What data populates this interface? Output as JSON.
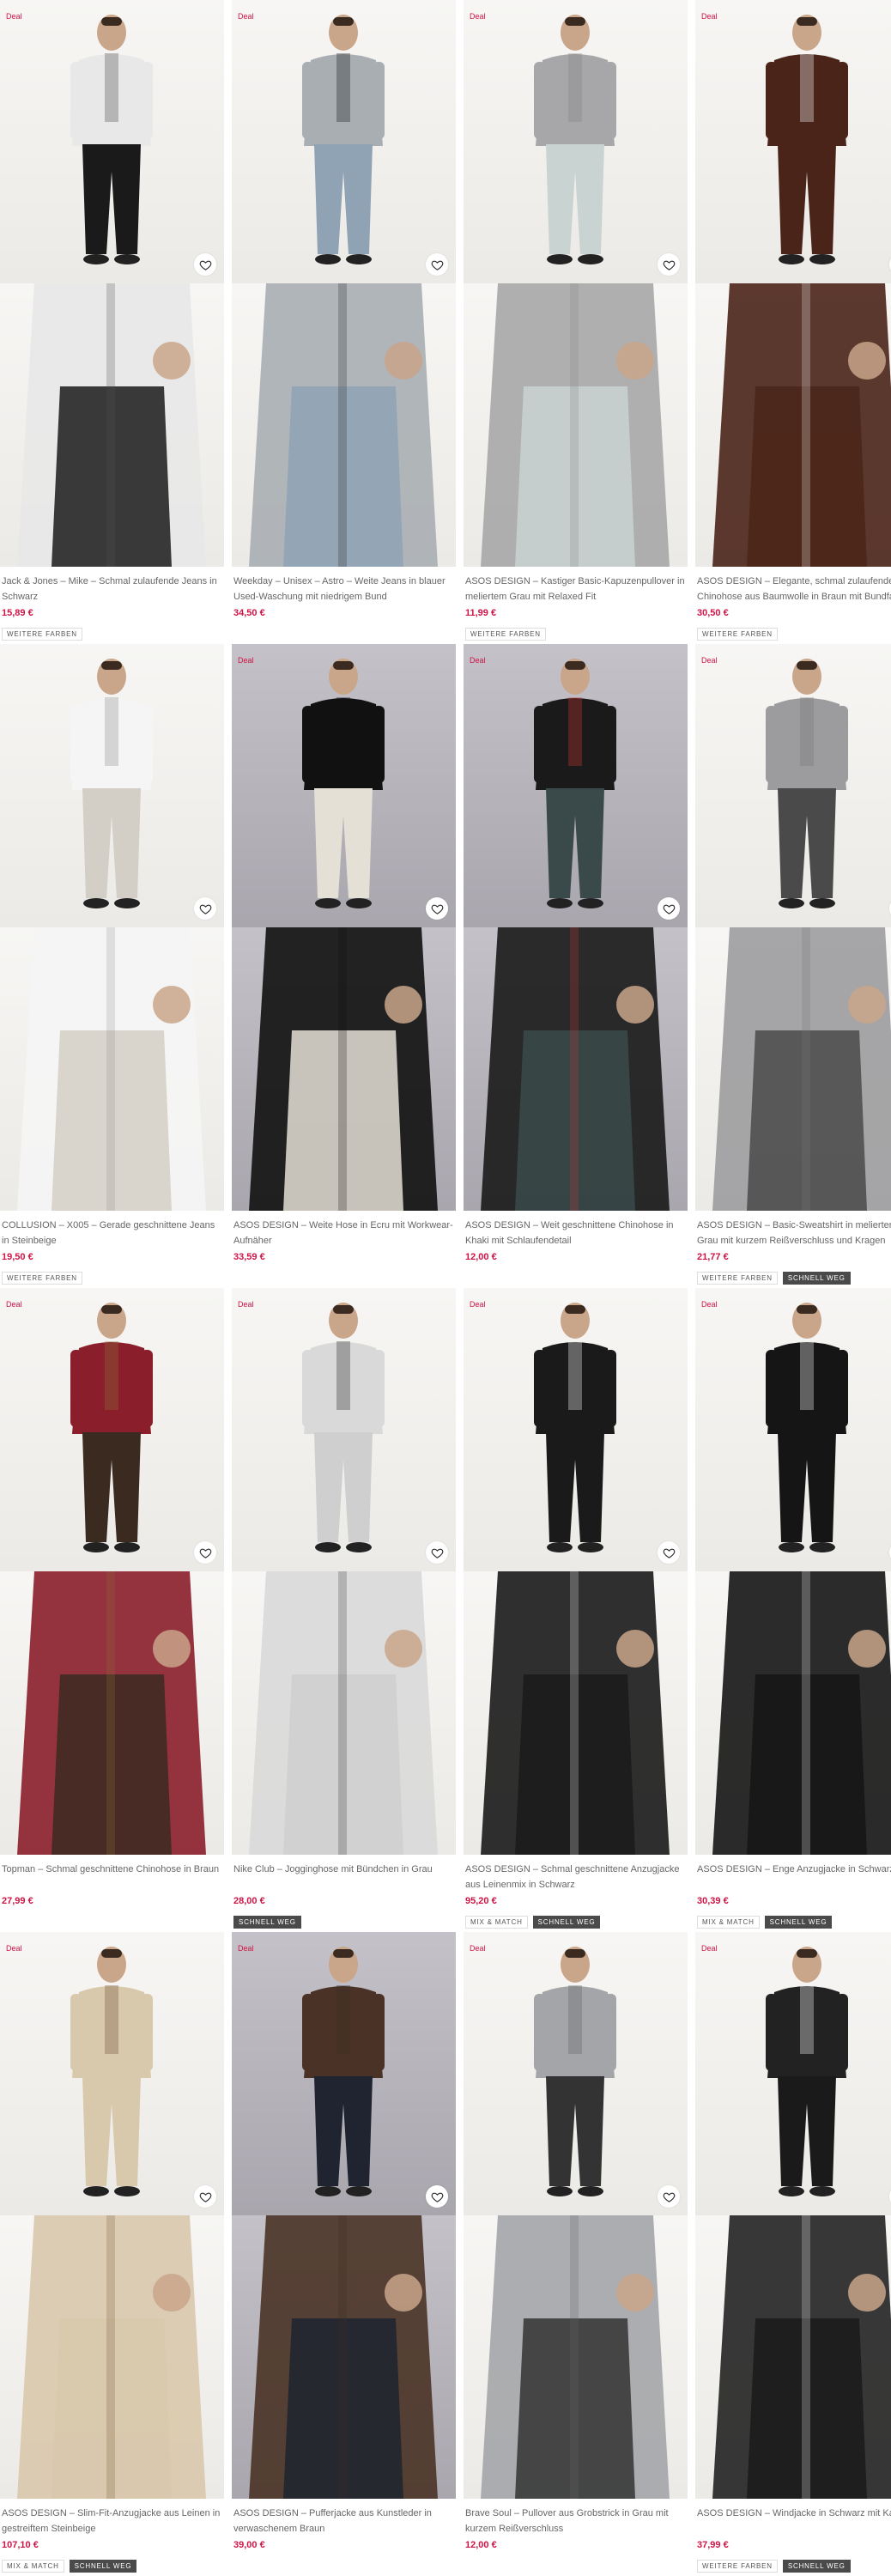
{
  "deal_label": "Deal",
  "products": [
    {
      "title": "Jack & Jones – Mike – Schmal zulaufende Jeans in Schwarz",
      "price": "15,89 €",
      "tags": [
        "WEITERE FARBEN"
      ],
      "deal": true,
      "tone": "light",
      "shirt": "#e8e8e8",
      "pants": "#1a1a1a",
      "accent": "#555"
    },
    {
      "title": "Weekday – Unisex – Astro – Weite Jeans in blauer Used-Waschung mit niedrigem Bund",
      "price": "34,50 €",
      "tags": [],
      "deal": true,
      "tone": "light",
      "shirt": "#a9aeb2",
      "pants": "#8fa3b5",
      "accent": "#222"
    },
    {
      "title": "ASOS DESIGN – Kastiger Basic-Kapuzenpullover in meliertem Grau mit Relaxed Fit",
      "price": "11,99 €",
      "tags": [
        "WEITERE FARBEN"
      ],
      "deal": true,
      "tone": "light",
      "shirt": "#a7a7a9",
      "pants": "#c9d4d2",
      "accent": "#888"
    },
    {
      "title": "ASOS DESIGN – Elegante, schmal zulaufende Chinohose aus Baumwolle in Braun mit Bundfalten",
      "price": "30,50 €",
      "tags": [
        "WEITERE FARBEN"
      ],
      "deal": true,
      "tone": "light",
      "shirt": "#4a2418",
      "pants": "#4a2418",
      "accent": "#f3f3f3"
    },
    {
      "title": "COLLUSION – X005 – Gerade geschnittene Jeans in Steinbeige",
      "price": "19,50 €",
      "tags": [
        "WEITERE FARBEN"
      ],
      "deal": false,
      "tone": "light",
      "shirt": "#f5f5f5",
      "pants": "#d3cfc6",
      "accent": "#999"
    },
    {
      "title": "ASOS DESIGN – Weite Hose in Ecru mit Workwear-Aufnäher",
      "price": "33,59 €",
      "tags": [],
      "deal": true,
      "tone": "dark",
      "shirt": "#111111",
      "pants": "#e5e0d6",
      "accent": "#111"
    },
    {
      "title": "ASOS DESIGN – Weit geschnittene Chinohose in Khaki mit Schlaufendetail",
      "price": "12,00 €",
      "tags": [],
      "deal": true,
      "tone": "dark",
      "shirt": "#1a1a1a",
      "pants": "#3a4a4a",
      "accent": "#c83737"
    },
    {
      "title": "ASOS DESIGN – Basic-Sweatshirt in meliertem Grau mit kurzem Reißverschluss und Kragen",
      "price": "21,77 €",
      "tags": [
        "WEITERE FARBEN",
        "SCHNELL WEG"
      ],
      "deal": true,
      "tone": "light",
      "shirt": "#9c9c9e",
      "pants": "#4a4a4a",
      "accent": "#777"
    },
    {
      "title": "Topman – Schmal geschnittene Chinohose in Braun",
      "price": "27,99 €",
      "tags": [],
      "deal": true,
      "tone": "light",
      "shirt": "#8a1e2a",
      "pants": "#3b2a20",
      "accent": "#8a6a3c"
    },
    {
      "title": "Nike Club – Jogginghose mit Bündchen in Grau",
      "price": "28,00 €",
      "tags": [
        "SCHNELL WEG"
      ],
      "deal": true,
      "tone": "light",
      "shirt": "#d9d9d9",
      "pants": "#cfcfcf",
      "accent": "#333"
    },
    {
      "title": "ASOS DESIGN – Schmal geschnittene Anzugjacke aus Leinenmix in Schwarz",
      "price": "95,20 €",
      "tags": [
        "MIX & MATCH",
        "SCHNELL WEG"
      ],
      "deal": true,
      "tone": "light",
      "shirt": "#1a1a1a",
      "pants": "#1a1a1a",
      "accent": "#f0f0f0"
    },
    {
      "title": "ASOS DESIGN – Enge Anzugjacke in Schwarz",
      "price": "30,39 €",
      "tags": [
        "MIX & MATCH",
        "SCHNELL WEG"
      ],
      "deal": true,
      "tone": "light",
      "shirt": "#151515",
      "pants": "#151515",
      "accent": "#f0f0f0"
    },
    {
      "title": "ASOS DESIGN – Slim-Fit-Anzugjacke aus Leinen in gestreiftem Steinbeige",
      "price": "107,10 €",
      "tags": [
        "MIX & MATCH",
        "SCHNELL WEG"
      ],
      "deal": true,
      "tone": "light",
      "shirt": "#d8c8ac",
      "pants": "#d8c8ac",
      "accent": "#7a5a3a"
    },
    {
      "title": "ASOS DESIGN – Pufferjacke aus Kunstleder in verwaschenem Braun",
      "price": "39,00 €",
      "tags": [],
      "deal": true,
      "tone": "dark",
      "shirt": "#4a3326",
      "pants": "#1f2430",
      "accent": "#3a2a22"
    },
    {
      "title": "Brave Soul – Pullover aus Grobstrick in Grau mit kurzem Reißverschluss",
      "price": "12,00 €",
      "tags": [],
      "deal": true,
      "tone": "light",
      "shirt": "#a3a5a8",
      "pants": "#333333",
      "accent": "#666"
    },
    {
      "title": "ASOS DESIGN – Windjacke in Schwarz mit Kapuze",
      "price": "37,99 €",
      "tags": [
        "WEITERE FARBEN",
        "SCHNELL WEG"
      ],
      "deal": true,
      "tone": "light",
      "shirt": "#222222",
      "pants": "#1a1a1a",
      "accent": "#f0f0f0"
    }
  ]
}
